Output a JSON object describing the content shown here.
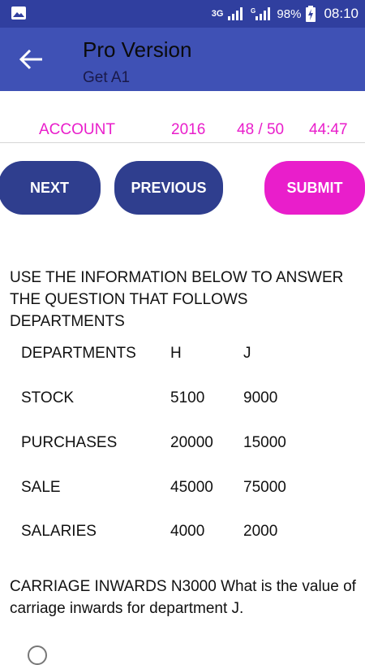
{
  "status_bar": {
    "network": "3G",
    "battery": "98%",
    "time": "08:10"
  },
  "app_bar": {
    "title": "Pro Version",
    "subtitle": "Get A1"
  },
  "info": {
    "subject": "ACCOUNT",
    "year": "2016",
    "progress": "48 / 50",
    "timer": "44:47"
  },
  "buttons": {
    "next": "NEXT",
    "previous": "PREVIOUS",
    "submit": "SUBMIT"
  },
  "question": {
    "intro": "USE THE INFORMATION BELOW TO ANSWER THE QUESTION THAT FOLLOWS DEPARTMENTS",
    "table": [
      [
        "DEPARTMENTS",
        "H",
        "J"
      ],
      [
        "STOCK",
        "5100",
        "9000"
      ],
      [
        "PURCHASES",
        "20000",
        "15000"
      ],
      [
        "SALE",
        "45000",
        "75000"
      ],
      [
        "SALARIES",
        "4000",
        "2000"
      ]
    ],
    "text": "CARRIAGE INWARDS N3000 What is the value of carriage inwards for department J."
  },
  "colors": {
    "status_bar": "#303f9f",
    "app_bar": "#3f51b5",
    "accent": "#e91ecb",
    "button": "#2f3e8e"
  }
}
